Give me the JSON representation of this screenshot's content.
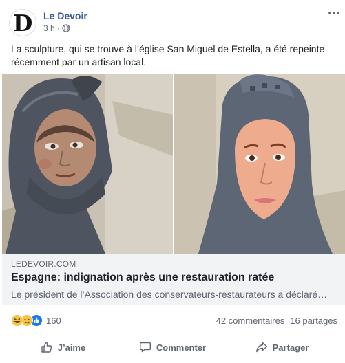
{
  "page": {
    "name": "Le Devoir",
    "avatar_letter": "D",
    "time": "3 h",
    "separator": "·",
    "audience_icon": "globe-icon",
    "more_icon": "more-dots-icon"
  },
  "post": {
    "text": "La sculpture, qui se trouve à l’église San Miguel de Estella, a été repeinte récemment par un artisan local."
  },
  "link_preview": {
    "domain": "LEDEVOIR.COM",
    "headline": "Espagne: indignation après une restauration ratée",
    "description": "Le président de l’Association des conservateurs-restaurateurs a déclaré…"
  },
  "engagement": {
    "reaction_icons": [
      "haha-icon",
      "sad-icon",
      "like-icon"
    ],
    "reaction_count": "160",
    "comments": "42 commentaires",
    "shares": "16 partages"
  },
  "actions": {
    "like": "J’aime",
    "comment": "Commenter",
    "share": "Partager"
  },
  "colors": {
    "name_link": "#385898",
    "secondary_text": "#606770",
    "preview_bg": "#f2f3f5",
    "like_blue": "#1877f2",
    "emoji_yellow": "#f7c544"
  }
}
